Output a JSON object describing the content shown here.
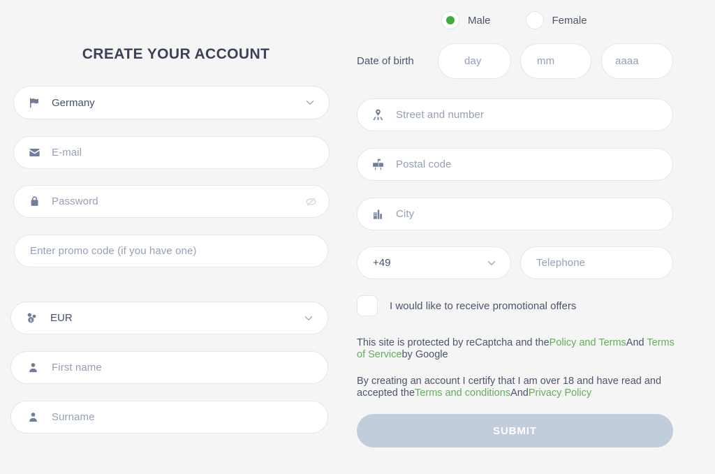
{
  "page": {
    "background": "#f5f5f6",
    "accent_green": "#43aa3c",
    "link_green": "#60b155",
    "text_dark": "#3b4257",
    "placeholder": "#96a0b4"
  },
  "left": {
    "title": "CREATE YOUR ACCOUNT",
    "country": {
      "icon": "flag-icon",
      "value": "Germany",
      "chevron": "chevron-down-icon"
    },
    "email": {
      "icon": "envelope-icon",
      "placeholder": "E-mail",
      "value": ""
    },
    "password": {
      "icon": "lock-icon",
      "placeholder": "Password",
      "value": "",
      "toggle_icon": "eye-off-icon"
    },
    "promo": {
      "placeholder": "Enter promo code (if you have one)",
      "value": ""
    },
    "currency": {
      "icon": "coins-icon",
      "value": "EUR",
      "chevron": "chevron-down-icon"
    },
    "first_name": {
      "icon": "user-icon",
      "placeholder": "First name",
      "value": ""
    },
    "surname": {
      "icon": "user-icon",
      "placeholder": "Surname",
      "value": ""
    }
  },
  "right": {
    "gender": {
      "selected": "Male",
      "options": [
        {
          "label": "Male",
          "checked": true
        },
        {
          "label": "Female",
          "checked": false
        }
      ]
    },
    "dob": {
      "label": "Date of birth",
      "day": {
        "placeholder": "day",
        "value": ""
      },
      "month": {
        "placeholder": "mm",
        "value": ""
      },
      "year": {
        "placeholder": "aaaa",
        "value": ""
      }
    },
    "street": {
      "icon": "street-pin-icon",
      "placeholder": "Street and number",
      "value": ""
    },
    "postal": {
      "icon": "mailbox-icon",
      "placeholder": "Postal code",
      "value": ""
    },
    "city": {
      "icon": "city-building-icon",
      "placeholder": "City",
      "value": ""
    },
    "phone_prefix": {
      "value": "+49",
      "chevron": "chevron-down-icon"
    },
    "telephone": {
      "placeholder": "Telephone",
      "value": ""
    },
    "promotional_offers": {
      "label": "I would like to receive promotional offers",
      "checked": false
    },
    "legal_recaptcha": {
      "part1": "This site is protected by reCaptcha and the",
      "link1": "Policy and Terms",
      "part2": "And ",
      "link2": "Terms of Service",
      "part3": "by Google"
    },
    "legal_terms": {
      "part1": "By creating an account I certify that I am over 18 and have read and accepted the",
      "link1": "Terms and conditions",
      "part2": "And",
      "link2": "Privacy Policy"
    },
    "submit_label": "SUBMIT"
  }
}
